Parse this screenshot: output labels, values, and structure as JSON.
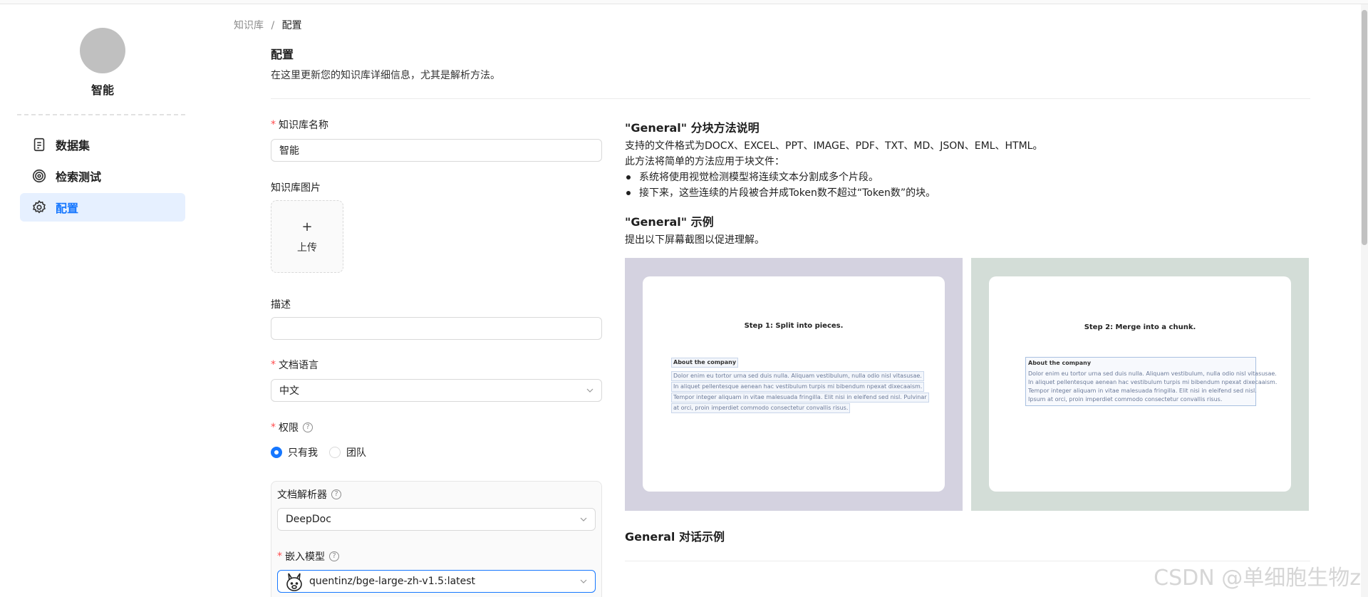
{
  "sidebar": {
    "kb_name": "智能",
    "items": [
      {
        "label": "数据集",
        "icon": "document-icon"
      },
      {
        "label": "检索测试",
        "icon": "target-icon"
      },
      {
        "label": "配置",
        "icon": "gear-icon",
        "active": true
      }
    ]
  },
  "breadcrumb": {
    "root": "知识库",
    "separator": "/",
    "current": "配置"
  },
  "header": {
    "title": "配置",
    "subtitle": "在这里更新您的知识库详细信息，尤其是解析方法。"
  },
  "form": {
    "name_label": "知识库名称",
    "name_value": "智能",
    "image_label": "知识库图片",
    "upload_plus": "+",
    "upload_label": "上传",
    "description_label": "描述",
    "description_value": "",
    "language_label": "文档语言",
    "language_value": "中文",
    "permission_label": "权限",
    "permission_options": [
      "只有我",
      "团队"
    ],
    "permission_selected": "只有我",
    "parser_label": "文档解析器",
    "parser_value": "DeepDoc",
    "embedding_label": "嵌入模型",
    "embedding_value": "quentinz/bge-large-zh-v1.5:latest",
    "help_glyph": "?"
  },
  "help": {
    "method_title": "\"General\" 分块方法说明",
    "supported_formats": "支持的文件格式为DOCX、EXCEL、PPT、IMAGE、PDF、TXT、MD、JSON、EML、HTML。",
    "method_desc": "此方法将简单的方法应用于块文件：",
    "bullets": [
      "系统将使用视觉检测模型将连续文本分割成多个片段。",
      "接下来，这些连续的片段被合并成Token数不超过“Token数”的块。"
    ],
    "example_title": "\"General\" 示例",
    "example_desc": "提出以下屏幕截图以促进理解。",
    "dialog_title": "General 对话示例",
    "example1": {
      "step": "Step 1: Split into pieces.",
      "heading": "About the company",
      "lines": [
        "Dolor enim eu tortor urna sed duis nulla. Aliquam vestibulum, nulla odio nisl vitasusae.",
        "In aliquet pellentesque aenean hac vestibulum turpis mi bibendum npexat dixecaaism.",
        "Tempor integer aliquam in vitae malesuada fringilla. Elit nisi in eleifend sed nisl. Pulvinar",
        "at orci, proin imperdiet commodo consectetur convallis risus."
      ]
    },
    "example2": {
      "step": "Step 2: Merge into a chunk.",
      "heading": "About the company",
      "lines": [
        "Dolor enim eu tortor urna sed duis nulla. Aliquam vestibulum, nulla odio nisl vitasusae.",
        "In aliquet pellentesque aenean hac vestibulum turpis mi bibendum npexat dixecaaism.",
        "Tempor integer aliquam in vitae malesuada fringilla. Elit nisi in eleifend sed nisl.",
        "Ipsum at orci, proin imperdiet commodo consectetur convallis risus."
      ]
    }
  },
  "watermark": "CSDN @单细胞生物z",
  "colors": {
    "accent": "#1677ff",
    "example1_bg": "#d4d2e0",
    "example2_bg": "#d3ddd7"
  }
}
